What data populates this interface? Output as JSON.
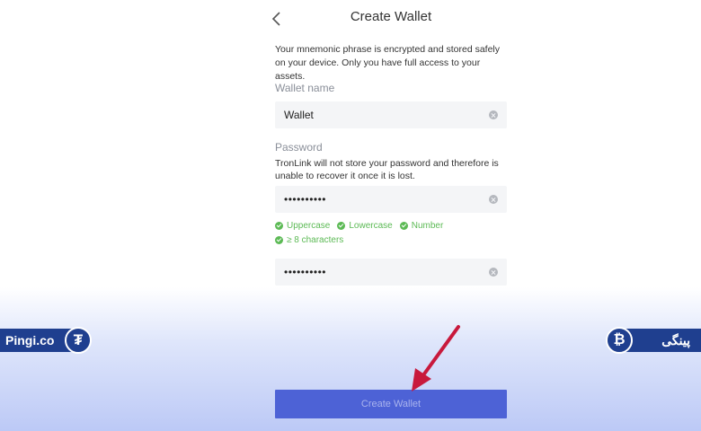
{
  "header": {
    "title": "Create Wallet"
  },
  "intro_text": "Your mnemonic phrase is encrypted and stored safely on your device. Only you have full access to your assets.",
  "wallet_name": {
    "label": "Wallet name",
    "value": "Wallet"
  },
  "password": {
    "label": "Password",
    "note": "TronLink will not store your password and therefore is unable to recover it once it is lost.",
    "value": "••••••••••",
    "confirm_value": "••••••••••"
  },
  "rules": [
    "Uppercase",
    "Lowercase",
    "Number",
    "≥ 8 characters"
  ],
  "create_button_label": "Create Wallet",
  "watermark": {
    "left_text": "Pingi.co",
    "left_icon_glyph": "₮",
    "right_text": "پینگی",
    "right_icon_glyph": "₿"
  },
  "colors": {
    "accent": "#4d62d6",
    "rule_ok": "#5cba55",
    "brand": "#1f3f8f",
    "annotation_arrow": "#c8193c"
  },
  "icons": {
    "back": "chevron-left-icon",
    "clear": "clear-icon",
    "rule": "check-circle-icon",
    "left_brand": "tether-icon",
    "right_brand": "bitcoin-icon"
  }
}
